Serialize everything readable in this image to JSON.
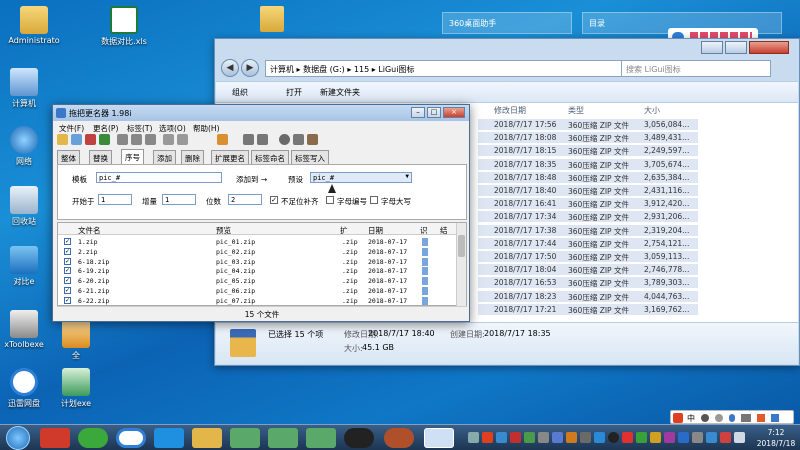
{
  "desktop": {
    "icons": [
      {
        "label": "Administrato"
      },
      {
        "label": "数据对比.xls"
      },
      {
        "label": "计算机"
      },
      {
        "label": "网络"
      },
      {
        "label": "回收站"
      },
      {
        "label": "对比e"
      },
      {
        "label": "xToolbexe"
      },
      {
        "label": "迅雷网盘"
      },
      {
        "label": "计划exe"
      },
      {
        "label": "全"
      }
    ],
    "gadget_left": "360桌面助手",
    "gadget_right": "目录"
  },
  "explorer": {
    "breadcrumb": [
      "计算机",
      "数据盘 (G:)",
      "115",
      "LiGui图标"
    ],
    "search_placeholder": "搜索 LiGui图标",
    "toolbar": {
      "organize": "组织",
      "open": "打开",
      "new_folder": "新建文件夹"
    },
    "columns": {
      "date": "修改日期",
      "type": "类型",
      "size": "大小"
    },
    "rows": [
      {
        "date": "2018/7/17 17:56",
        "type": "360压缩 ZIP 文件",
        "size": "3,056,084..."
      },
      {
        "date": "2018/7/17 18:08",
        "type": "360压缩 ZIP 文件",
        "size": "3,489,431..."
      },
      {
        "date": "2018/7/17 18:15",
        "type": "360压缩 ZIP 文件",
        "size": "2,249,597..."
      },
      {
        "date": "2018/7/17 18:35",
        "type": "360压缩 ZIP 文件",
        "size": "3,705,674..."
      },
      {
        "date": "2018/7/17 18:48",
        "type": "360压缩 ZIP 文件",
        "size": "2,635,384..."
      },
      {
        "date": "2018/7/17 18:40",
        "type": "360压缩 ZIP 文件",
        "size": "2,431,116..."
      },
      {
        "date": "2018/7/17 16:41",
        "type": "360压缩 ZIP 文件",
        "size": "3,912,420..."
      },
      {
        "date": "2018/7/17 17:34",
        "type": "360压缩 ZIP 文件",
        "size": "2,931,206..."
      },
      {
        "date": "2018/7/17 17:38",
        "type": "360压缩 ZIP 文件",
        "size": "2,319,204..."
      },
      {
        "date": "2018/7/17 17:44",
        "type": "360压缩 ZIP 文件",
        "size": "2,754,121..."
      },
      {
        "date": "2018/7/17 17:50",
        "type": "360压缩 ZIP 文件",
        "size": "3,059,113..."
      },
      {
        "date": "2018/7/17 18:04",
        "type": "360压缩 ZIP 文件",
        "size": "2,746,778..."
      },
      {
        "date": "2018/7/17 16:53",
        "type": "360压缩 ZIP 文件",
        "size": "3,789,303..."
      },
      {
        "date": "2018/7/17 18:23",
        "type": "360压缩 ZIP 文件",
        "size": "4,044,763..."
      },
      {
        "date": "2018/7/17 17:21",
        "type": "360压缩 ZIP 文件",
        "size": "3,169,762..."
      }
    ],
    "status": {
      "selected": "已选择 15 个项",
      "modified_label": "修改日期:",
      "modified_value": "2018/7/17 18:40",
      "created_label": "创建日期:",
      "created_value": "2018/7/17 18:35",
      "size_label": "大小:",
      "size_value": "45.1 GB"
    }
  },
  "renamer": {
    "title": "拖把更名器 1.98i",
    "menu": [
      "文件(F)",
      "更名(P)",
      "标签(T)",
      "选项(O)",
      "帮助(H)"
    ],
    "tabs": [
      "整体",
      "替换",
      "序号",
      "添加",
      "删除",
      "扩展更名",
      "标签命名",
      "标签写入"
    ],
    "active_tab": "序号",
    "template_label": "模板",
    "template_value": "pic_#",
    "add_to_label": "添加到 →",
    "preset_label": "预设",
    "preset_value": "pic_#",
    "start_label": "开始于",
    "start_value": "1",
    "step_label": "增量",
    "step_value": "1",
    "digits_label": "位数",
    "digits_value": "2",
    "options": [
      {
        "label": "不足位补齐",
        "checked": true
      },
      {
        "label": "字母编号",
        "checked": false
      },
      {
        "label": "字母大写",
        "checked": false
      }
    ],
    "list_columns": [
      "文件名",
      "预览",
      "扩",
      "日期",
      "识",
      "结"
    ],
    "files": [
      {
        "name": "1.zip",
        "preview": "pic_01.zip",
        "ext": ".zip",
        "date": "2018-07-17"
      },
      {
        "name": "2.zip",
        "preview": "pic_02.zip",
        "ext": ".zip",
        "date": "2018-07-17"
      },
      {
        "name": "6-18.zip",
        "preview": "pic_03.zip",
        "ext": ".zip",
        "date": "2018-07-17"
      },
      {
        "name": "6-19.zip",
        "preview": "pic_04.zip",
        "ext": ".zip",
        "date": "2018-07-17"
      },
      {
        "name": "6-20.zip",
        "preview": "pic_05.zip",
        "ext": ".zip",
        "date": "2018-07-17"
      },
      {
        "name": "6-21.zip",
        "preview": "pic_06.zip",
        "ext": ".zip",
        "date": "2018-07-17"
      },
      {
        "name": "6-22.zip",
        "preview": "pic_07.zip",
        "ext": ".zip",
        "date": "2018-07-17"
      }
    ],
    "status": "15 个文件"
  },
  "taskbar": {
    "ime_label": "中",
    "time": "7:12",
    "date": "2018/7/18"
  }
}
